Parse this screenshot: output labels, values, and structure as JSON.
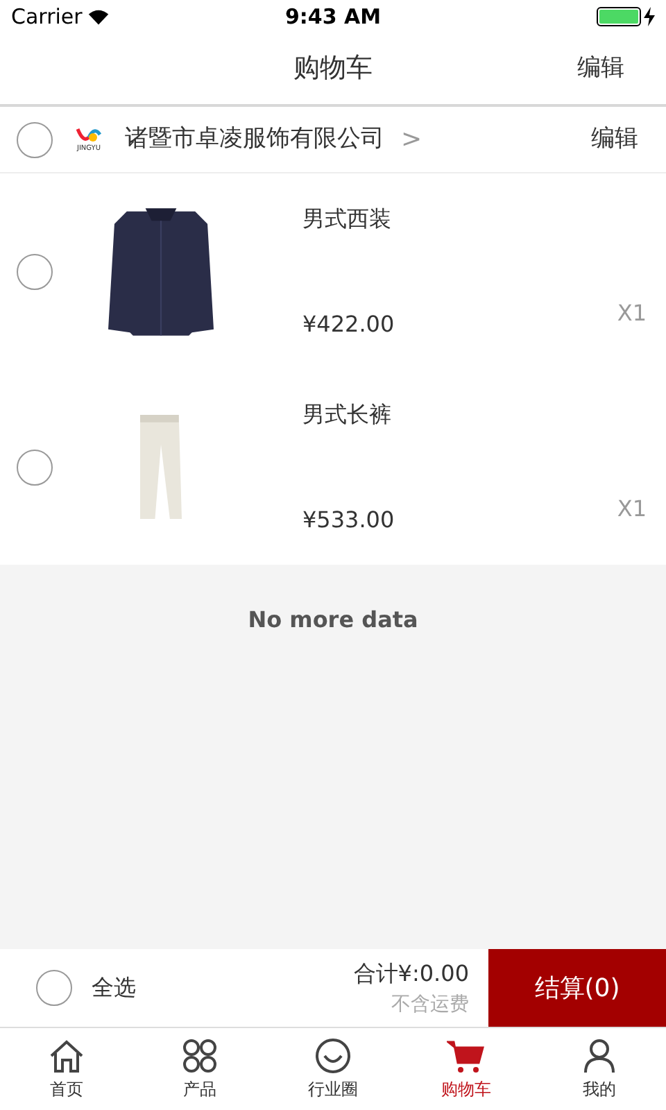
{
  "status_bar": {
    "carrier": "Carrier",
    "time": "9:43 AM"
  },
  "nav": {
    "title": "购物车",
    "action": "编辑"
  },
  "shop": {
    "checked": false,
    "logo_text": "JINGYU",
    "name": "诸暨市卓凌服饰有限公司",
    "chevron": ">",
    "action": "编辑"
  },
  "items": [
    {
      "checked": false,
      "kind": "jacket",
      "name": "男式西装",
      "price": "¥422.00",
      "quantity": "X1"
    },
    {
      "checked": false,
      "kind": "pants",
      "name": "男式长裤",
      "price": "¥533.00",
      "quantity": "X1"
    }
  ],
  "footer_note": "No more data",
  "checkout_bar": {
    "select_all": {
      "checked": false,
      "label": "全选"
    },
    "total": "合计¥:0.00",
    "shipping_note": "不含运费",
    "checkout_button": "结算(0)"
  },
  "tab_bar": [
    {
      "kind": "home",
      "label": "首页",
      "selected": false
    },
    {
      "kind": "products",
      "label": "产品",
      "selected": false
    },
    {
      "kind": "circle",
      "label": "行业圈",
      "selected": false
    },
    {
      "kind": "cart",
      "label": "购物车",
      "selected": true
    },
    {
      "kind": "me",
      "label": "我的",
      "selected": false
    }
  ]
}
